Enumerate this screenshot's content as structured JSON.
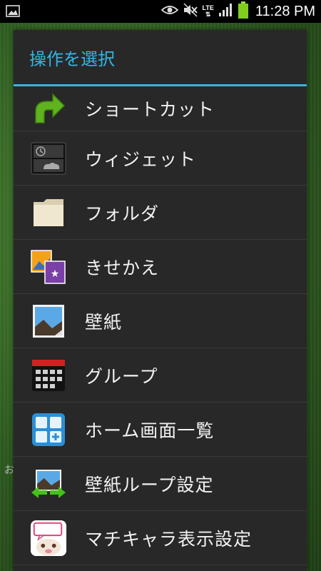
{
  "status_bar": {
    "time": "11:28 PM",
    "network": "LTE",
    "icons": [
      "gallery-icon",
      "eye-icon",
      "mute-icon",
      "lte-icon",
      "signal-icon",
      "battery-icon"
    ]
  },
  "background": {
    "peek_text": "お"
  },
  "dialog": {
    "title": "操作を選択",
    "accent_color": "#33b5e5",
    "items": [
      {
        "label": "ショートカット",
        "icon": "shortcut-arrow-icon"
      },
      {
        "label": "ウィジェット",
        "icon": "widget-icon"
      },
      {
        "label": "フォルダ",
        "icon": "folder-icon"
      },
      {
        "label": "きせかえ",
        "icon": "theme-icon"
      },
      {
        "label": "壁紙",
        "icon": "wallpaper-icon"
      },
      {
        "label": "グループ",
        "icon": "group-calendar-icon"
      },
      {
        "label": "ホーム画面一覧",
        "icon": "home-screen-list-icon"
      },
      {
        "label": "壁紙ループ設定",
        "icon": "wallpaper-loop-icon"
      },
      {
        "label": "マチキャラ表示設定",
        "icon": "machi-chara-icon"
      }
    ]
  }
}
